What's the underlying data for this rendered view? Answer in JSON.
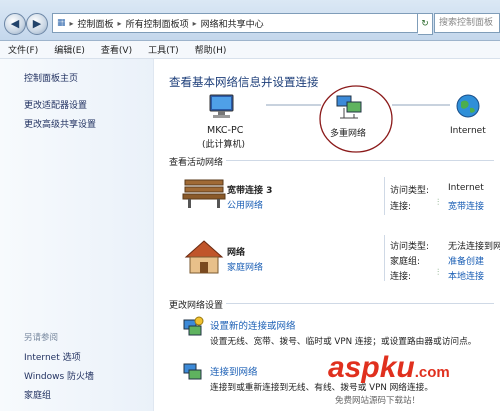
{
  "nav": {
    "breadcrumbs": [
      "控制面板",
      "所有控制面板项",
      "网络和共享中心"
    ],
    "search_placeholder": "搜索控制面板"
  },
  "menu": [
    "文件(F)",
    "编辑(E)",
    "查看(V)",
    "工具(T)",
    "帮助(H)"
  ],
  "sidebar": {
    "links": [
      "控制面板主页",
      "更改适配器设置",
      "更改高级共享设置"
    ],
    "see_also_title": "另请参阅",
    "see_also": [
      "Internet 选项",
      "Windows 防火墙",
      "家庭组"
    ]
  },
  "main": {
    "heading": "查看基本网络信息并设置连接",
    "map": {
      "computer_name": "MKC-PC",
      "computer_sub": "(此计算机)",
      "middle": "多重网络",
      "internet": "Internet"
    },
    "active_title": "查看活动网络",
    "networks": [
      {
        "name": "宽带连接  3",
        "type": "公用网络",
        "access_label": "访问类型:",
        "access_value": "Internet",
        "conn_label": "连接:",
        "conn_value": "宽带连接"
      },
      {
        "name": "网络",
        "type": "家庭网络",
        "access_label": "访问类型:",
        "access_value": "无法连接到网",
        "home_label": "家庭组:",
        "home_value": "准备创建",
        "conn_label": "连接:",
        "conn_value": "本地连接"
      }
    ],
    "change_title": "更改网络设置",
    "tasks": [
      {
        "title": "设置新的连接或网络",
        "desc": "设置无线、宽带、拨号、临时或 VPN 连接；或设置路由器或访问点。"
      },
      {
        "title": "连接到网络",
        "desc": "连接到或重新连接到无线、有线、拨号或 VPN 网络连接。"
      }
    ]
  },
  "watermark": {
    "brand": "aspku",
    "suffix": ".com",
    "tagline": "免费网站源码下载站！"
  }
}
